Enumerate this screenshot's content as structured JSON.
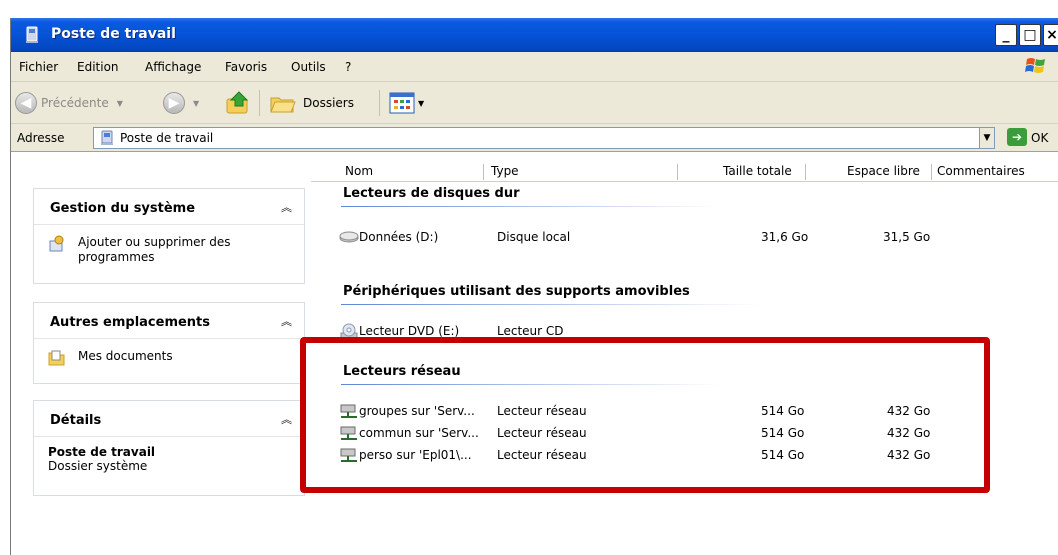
{
  "window": {
    "title": "Poste de travail"
  },
  "menu": [
    "Fichier",
    "Edition",
    "Affichage",
    "Favoris",
    "Outils",
    "?"
  ],
  "toolbar": {
    "back_label": "Précédente",
    "folders_label": "Dossiers"
  },
  "address": {
    "label": "Adresse",
    "value": "Poste de travail",
    "go_label": "OK"
  },
  "sidebar": {
    "panels": [
      {
        "title": "Gestion du système",
        "items": [
          "Ajouter ou supprimer des programmes"
        ]
      },
      {
        "title": "Autres emplacements",
        "items": [
          "Mes documents"
        ]
      },
      {
        "title": "Détails",
        "name": "Poste de travail",
        "subtitle": "Dossier système"
      }
    ]
  },
  "columns": [
    "Nom",
    "Type",
    "Taille totale",
    "Espace libre",
    "Commentaires"
  ],
  "groups": [
    {
      "title": "Lecteurs de disques dur",
      "rows": [
        {
          "name": "Données (D:)",
          "type": "Disque local",
          "total": "31,6 Go",
          "free": "31,5 Go"
        }
      ]
    },
    {
      "title": "Périphériques utilisant des supports amovibles",
      "rows": [
        {
          "name": "Lecteur DVD (E:)",
          "type": "Lecteur CD",
          "total": "",
          "free": ""
        }
      ]
    },
    {
      "title": "Lecteurs réseau",
      "rows": [
        {
          "name": "groupes sur 'Serv...",
          "type": "Lecteur réseau",
          "total": "514 Go",
          "free": "432 Go"
        },
        {
          "name": "commun sur 'Serv...",
          "type": "Lecteur réseau",
          "total": "514 Go",
          "free": "432 Go"
        },
        {
          "name": "perso sur 'Epl01\\...",
          "type": "Lecteur réseau",
          "total": "514 Go",
          "free": "432 Go"
        }
      ]
    }
  ],
  "colors": {
    "titlebar": "#0553d6",
    "highlight": "#c40000",
    "chrome": "#ece9d8"
  }
}
